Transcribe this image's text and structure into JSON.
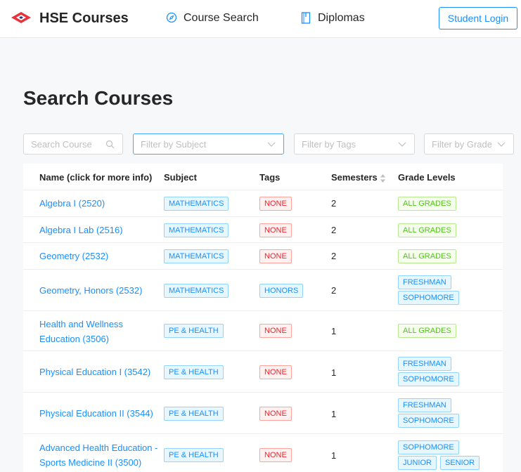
{
  "nav": {
    "brand": "HSE Courses",
    "course_search": "Course Search",
    "diplomas": "Diplomas",
    "login": "Student Login"
  },
  "page": {
    "title": "Search Courses"
  },
  "filters": {
    "search_placeholder": "Search Course",
    "subject_placeholder": "Filter by Subject",
    "tags_placeholder": "Filter by Tags",
    "grade_placeholder": "Filter by Grade"
  },
  "table": {
    "headers": {
      "name": "Name (click for more info)",
      "subject": "Subject",
      "tags": "Tags",
      "semesters": "Semesters",
      "grades": "Grade Levels"
    },
    "rows": [
      {
        "name": "Algebra I (2520)",
        "subject": "MATHEMATICS",
        "tag": "NONE",
        "semesters": "2",
        "grades": [
          "ALL GRADES"
        ]
      },
      {
        "name": "Algebra I Lab (2516)",
        "subject": "MATHEMATICS",
        "tag": "NONE",
        "semesters": "2",
        "grades": [
          "ALL GRADES"
        ]
      },
      {
        "name": "Geometry (2532)",
        "subject": "MATHEMATICS",
        "tag": "NONE",
        "semesters": "2",
        "grades": [
          "ALL GRADES"
        ]
      },
      {
        "name": "Geometry, Honors (2532)",
        "subject": "MATHEMATICS",
        "tag": "HONORS",
        "semesters": "2",
        "grades": [
          "FRESHMAN",
          "SOPHOMORE"
        ]
      },
      {
        "name": "Health and Wellness Education (3506)",
        "subject": "PE & HEALTH",
        "tag": "NONE",
        "semesters": "1",
        "grades": [
          "ALL GRADES"
        ]
      },
      {
        "name": "Physical Education I (3542)",
        "subject": "PE & HEALTH",
        "tag": "NONE",
        "semesters": "1",
        "grades": [
          "FRESHMAN",
          "SOPHOMORE"
        ]
      },
      {
        "name": "Physical Education II (3544)",
        "subject": "PE & HEALTH",
        "tag": "NONE",
        "semesters": "1",
        "grades": [
          "FRESHMAN",
          "SOPHOMORE"
        ]
      },
      {
        "name": "Advanced Health Education - Sports Medicine II (3500)",
        "subject": "PE & HEALTH",
        "tag": "NONE",
        "semesters": "1",
        "grades": [
          "SOPHOMORE",
          "JUNIOR",
          "SENIOR"
        ]
      }
    ]
  }
}
